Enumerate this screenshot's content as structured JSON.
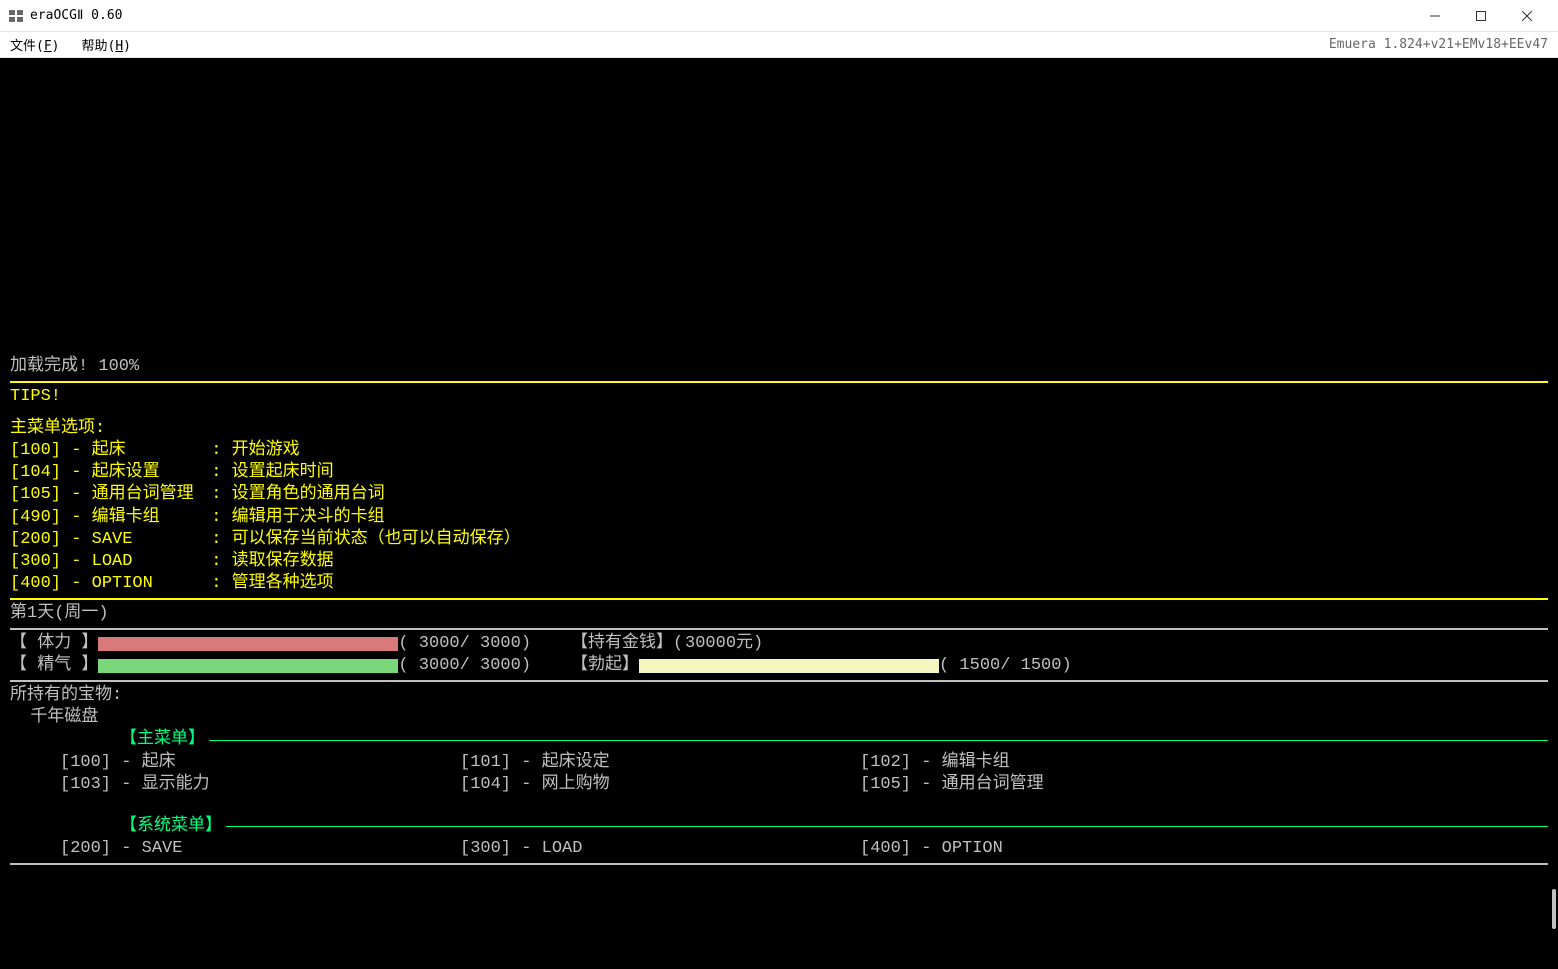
{
  "window": {
    "title": "eraOCGⅡ 0.60"
  },
  "menubar": {
    "file": "文件(",
    "file_u": "F",
    "file_end": ")",
    "help": "帮助(",
    "help_u": "H",
    "help_end": ")",
    "version": "Emuera 1.824+v21+EMv18+EEv47"
  },
  "game": {
    "load_complete": "加载完成! 100%",
    "tips": "TIPS!",
    "main_menu_header": "主菜单选项:",
    "tips_items": [
      {
        "id": "[100]",
        "name": "- 起床",
        "desc": ": 开始游戏"
      },
      {
        "id": "[104]",
        "name": "- 起床设置",
        "desc": ": 设置起床时间"
      },
      {
        "id": "[105]",
        "name": "- 通用台词管理",
        "desc": ": 设置角色的通用台词"
      },
      {
        "id": "[490]",
        "name": "- 编辑卡组",
        "desc": ": 编辑用于决斗的卡组"
      },
      {
        "id": "[200]",
        "name": "- SAVE",
        "desc": ": 可以保存当前状态（也可以自动保存）"
      },
      {
        "id": "[300]",
        "name": "- LOAD",
        "desc": ": 读取保存数据"
      },
      {
        "id": "[400]",
        "name": "- OPTION",
        "desc": ": 管理各种选项"
      }
    ],
    "day_label": "第1天(周一)",
    "stats": {
      "hp_label": "【 体力 】",
      "hp_value": "( 3000/ 3000)",
      "sp_label": "【 精气 】",
      "sp_value": "( 3000/ 3000)",
      "money_label": "【持有金钱】(",
      "money_value": "30000元)",
      "ej_label": "【勃起】",
      "ej_value": "( 1500/ 1500)"
    },
    "treasure_header": "所持有的宝物:",
    "treasure_item": "  千年磁盘",
    "section_main": "【主菜单】",
    "main_opts": [
      {
        "a": "[100] - 起床",
        "b": "[101] - 起床设定",
        "c": "[102] - 编辑卡组"
      },
      {
        "a": "[103] - 显示能力",
        "b": "[104] - 网上购物",
        "c": "[105] - 通用台词管理"
      }
    ],
    "section_sys": "【系统菜单】",
    "sys_opts": [
      {
        "a": "[200] - SAVE",
        "b": "[300] - LOAD",
        "c": "[400] - OPTION"
      }
    ]
  }
}
